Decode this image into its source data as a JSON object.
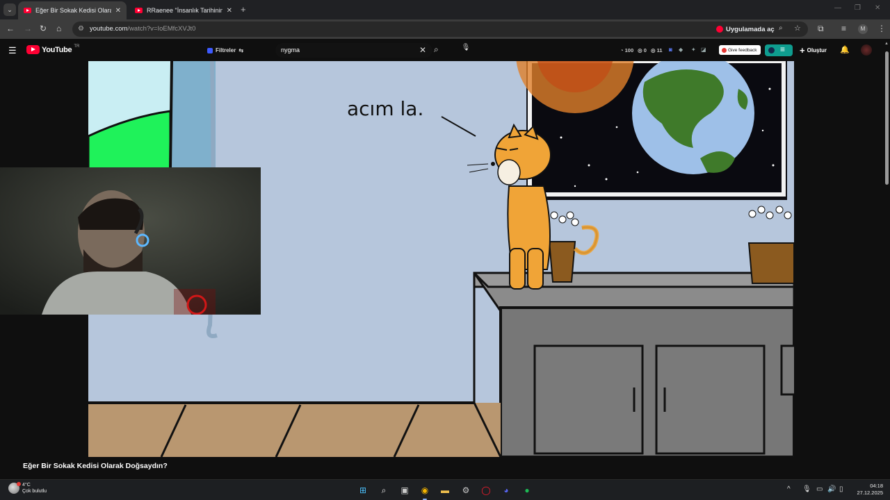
{
  "browser": {
    "tabs": [
      {
        "title": "Eğer Bir Sokak Kedisi Olarak Doğsaydın?",
        "active": true
      },
      {
        "title": "RRaenee \"İnsanlık Tarihinin En Büyük",
        "active": false
      }
    ],
    "url_main": "youtube.com",
    "url_rest": "/watch?v=IoEMfcXVJt0",
    "open_in_app_label": "Uygulamada aç",
    "profile_initial": "M"
  },
  "youtube": {
    "logo_word": "YouTube",
    "country_code": "TR",
    "filters_label": "Filtreler",
    "search_value": "nygma",
    "ext_stats": [
      "100",
      "0",
      "11"
    ],
    "feedback_label": "Give feedback",
    "create_label": "Oluştur",
    "video_title": "Eğer Bir Sokak Kedisi Olarak Doğsaydın?"
  },
  "video_frame": {
    "speech_text": "acım la."
  },
  "taskbar": {
    "weather_temp": "4°C",
    "weather_desc": "Çok bulutlu",
    "time": "04:18",
    "date": "27.12.2025"
  }
}
